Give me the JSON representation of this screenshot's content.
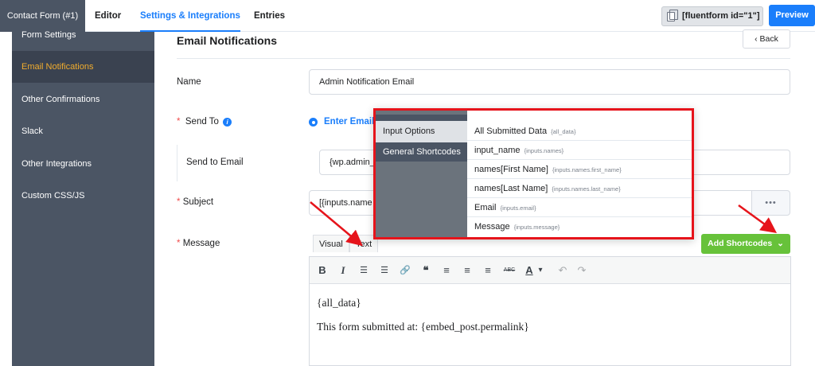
{
  "topbar": {
    "brand": "Contact Form (#1)",
    "tabs": [
      {
        "label": "Editor"
      },
      {
        "label": "Settings & Integrations"
      },
      {
        "label": "Entries"
      }
    ],
    "shortcode": "[fluentform id=\"1\"]",
    "preview_label": "Preview"
  },
  "sidebar": {
    "items": [
      {
        "label": "Form Settings"
      },
      {
        "label": "Email Notifications"
      },
      {
        "label": "Other Confirmations"
      },
      {
        "label": "Slack"
      },
      {
        "label": "Other Integrations"
      },
      {
        "label": "Custom CSS/JS"
      }
    ]
  },
  "main": {
    "title": "Email Notifications",
    "back_label": "Back",
    "name_label": "Name",
    "name_value": "Admin Notification Email",
    "required_mark": "*",
    "send_to_label": "Send To",
    "info_glyph": "i",
    "send_to_option": "Enter Email",
    "send_to_email_label": "Send to Email",
    "send_to_email_value": "{wp.admin_",
    "subject_label": "Subject",
    "subject_value": "[{inputs.name",
    "more_label": "•••",
    "message_label": "Message",
    "editor_tabs": [
      {
        "label": "Visual"
      },
      {
        "label": "Text"
      }
    ],
    "add_shortcodes_label": "Add Shortcodes",
    "add_shortcodes_caret": "⌄",
    "editor_body": [
      "{all_data}",
      "This form submitted at: {embed_post.permalink}"
    ]
  },
  "editor_toolbar": {
    "bold": "B",
    "italic": "I",
    "bullet_list": "☰",
    "numbered_list": "☰",
    "link": "🔗",
    "blockquote": "❝",
    "align_left": "≡",
    "align_center": "≡",
    "align_right": "≡",
    "strikethrough": "ABC",
    "text_color": "A",
    "text_color_caret": "▾",
    "undo": "↶",
    "redo": "↷"
  },
  "popup": {
    "groups": [
      {
        "label": "Input Options"
      },
      {
        "label": "General Shortcodes"
      }
    ],
    "items": [
      {
        "label": "All Submitted Data",
        "code": "{all_data}"
      },
      {
        "label": "input_name",
        "code": "{inputs.names}"
      },
      {
        "label": "names[First Name]",
        "code": "{inputs.names.first_name}"
      },
      {
        "label": "names[Last Name]",
        "code": "{inputs.names.last_name}"
      },
      {
        "label": "Email",
        "code": "{inputs.email}"
      },
      {
        "label": "Message",
        "code": "{inputs.message}"
      }
    ]
  },
  "colors": {
    "accent": "#1a7efb",
    "sidebar_bg": "#4b5564",
    "active_sidebar_text": "#f0ac2e",
    "success": "#67c23a",
    "highlight_red": "#e6141b"
  }
}
